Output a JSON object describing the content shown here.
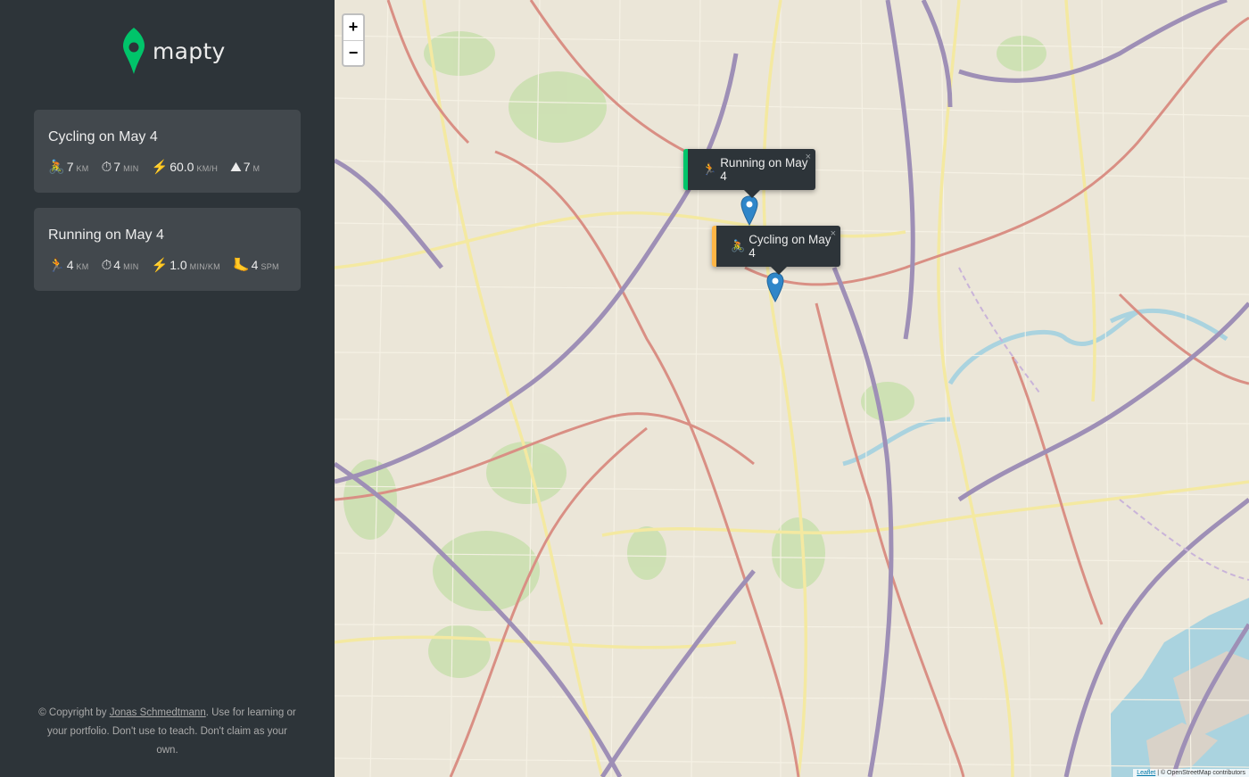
{
  "app": {
    "name": "mapty"
  },
  "workouts": [
    {
      "type": "cycling",
      "title": "Cycling on May 4",
      "accent": "#ffb545",
      "details": [
        {
          "icon": "🚴",
          "icon_name": "cycling-icon",
          "value": "7",
          "unit": "KM"
        },
        {
          "icon": "⏱",
          "icon_name": "stopwatch-icon",
          "value": "7",
          "unit": "MIN"
        },
        {
          "icon": "⚡",
          "icon_name": "lightning-icon",
          "value": "60.0",
          "unit": "KM/H"
        },
        {
          "icon": "⛰",
          "icon_name": "mountain-icon",
          "value": "7",
          "unit": "M"
        }
      ]
    },
    {
      "type": "running",
      "title": "Running on May 4",
      "accent": "#00c46a",
      "details": [
        {
          "icon": "🏃",
          "icon_name": "running-icon",
          "value": "4",
          "unit": "KM"
        },
        {
          "icon": "⏱",
          "icon_name": "stopwatch-icon",
          "value": "4",
          "unit": "MIN"
        },
        {
          "icon": "⚡",
          "icon_name": "lightning-icon",
          "value": "1.0",
          "unit": "MIN/KM"
        },
        {
          "icon": "🦶",
          "icon_name": "foot-icon",
          "value": "4",
          "unit": "SPM"
        }
      ]
    }
  ],
  "footer": {
    "prefix": "© Copyright by ",
    "author": "Jonas Schmedtmann",
    "suffix": ". Use for learning or your portfolio. Don't use to teach. Don't claim as your own."
  },
  "map": {
    "zoom_in": "+",
    "zoom_out": "−",
    "popups": {
      "running": {
        "icon": "🏃",
        "label": "Running on May 4",
        "close": "×"
      },
      "cycling": {
        "icon": "🚴",
        "label": "Cycling on May 4",
        "close": "×"
      }
    },
    "attribution": {
      "leaflet": "Leaflet",
      "rest": " | © OpenStreetMap contributors"
    }
  },
  "colors": {
    "running": "#00c46a",
    "cycling": "#ffb545",
    "sidebar": "#2d3439",
    "card": "#42484d"
  }
}
